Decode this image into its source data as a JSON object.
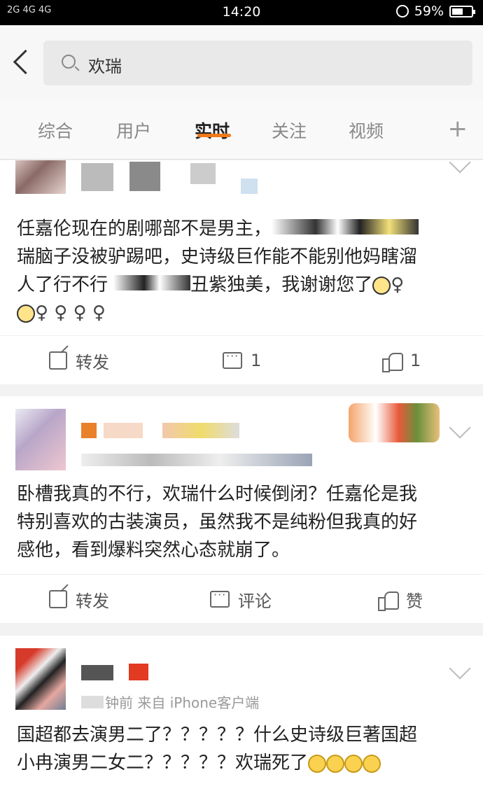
{
  "status_bar": {
    "network": "2G  4G 4G",
    "time": "14:20",
    "battery": "59%",
    "battery_level": 0.59
  },
  "search": {
    "query": "欢瑞"
  },
  "tabs": [
    {
      "label": "综合",
      "active": false
    },
    {
      "label": "用户",
      "active": false
    },
    {
      "label": "实时",
      "active": true
    },
    {
      "label": "关注",
      "active": false
    },
    {
      "label": "视频",
      "active": false
    }
  ],
  "tab_add_label": "+",
  "posts": [
    {
      "lines": [
        "任嘉伦现在的剧哪部不是男主，",
        "瑞脑子没被驴踢吧，史诗级巨作能不能别他妈瞎溜",
        "人了行不行",
        "丑紫独美，我谢谢您了",
        "♀",
        "♀ ♀ ♀ ♀"
      ],
      "repost_label": "转发",
      "comment_label": "1",
      "like_label": "1"
    },
    {
      "lines": [
        "卧槽我真的不行，欢瑞什么时候倒闭？任嘉伦是我",
        "特别喜欢的古装演员，虽然我不是纯粉但我真的好",
        "感他，看到爆料突然心态就崩了。"
      ],
      "repost_label": "转发",
      "comment_label": "评论",
      "like_label": "赞"
    },
    {
      "meta": "钟前   来自 iPhone客户端",
      "lines": [
        "国超都去演男二了？？？？？什么史诗级巨著国超",
        "小冉演男二女二？？？？？欢瑞死了"
      ]
    }
  ]
}
